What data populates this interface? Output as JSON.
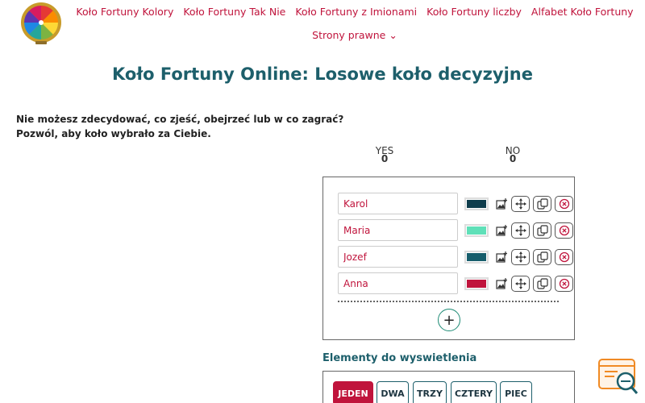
{
  "nav": {
    "links": [
      "Koło Fortuny Kolory",
      "Koło Fortuny Tak Nie",
      "Koło Fortuny z Imionami",
      "Koło Fortuny liczby",
      "Alfabet Koło Fortuny"
    ],
    "dropdown_label": "Strony prawne ⌄"
  },
  "page": {
    "title": "Koło Fortuny Online: Losowe koło decyzyjne",
    "intro_line1": "Nie możesz zdecydować, co zjeść, obejrzeć lub w co zagrać?",
    "intro_line2": "Pozwól, aby koło wybrało za Ciebie."
  },
  "scores": {
    "yes_label": "YES",
    "yes_value": "0",
    "no_label": "NO",
    "no_value": "0"
  },
  "entries": [
    {
      "name": "Karol",
      "color": "#0f3d4c"
    },
    {
      "name": "Maria",
      "color": "#5fe0b8"
    },
    {
      "name": "Jozef",
      "color": "#175e6c"
    },
    {
      "name": "Anna",
      "color": "#c0143c"
    }
  ],
  "add_label": "+",
  "display_section": {
    "heading": "Elementy do wyswietlenia",
    "tabs": [
      "JEDEN",
      "DWA",
      "TRZY",
      "CZTERY",
      "PIEC"
    ],
    "active": "JEDEN"
  },
  "colors": {
    "accent": "#c0143c",
    "heading": "#1d5f6b"
  }
}
